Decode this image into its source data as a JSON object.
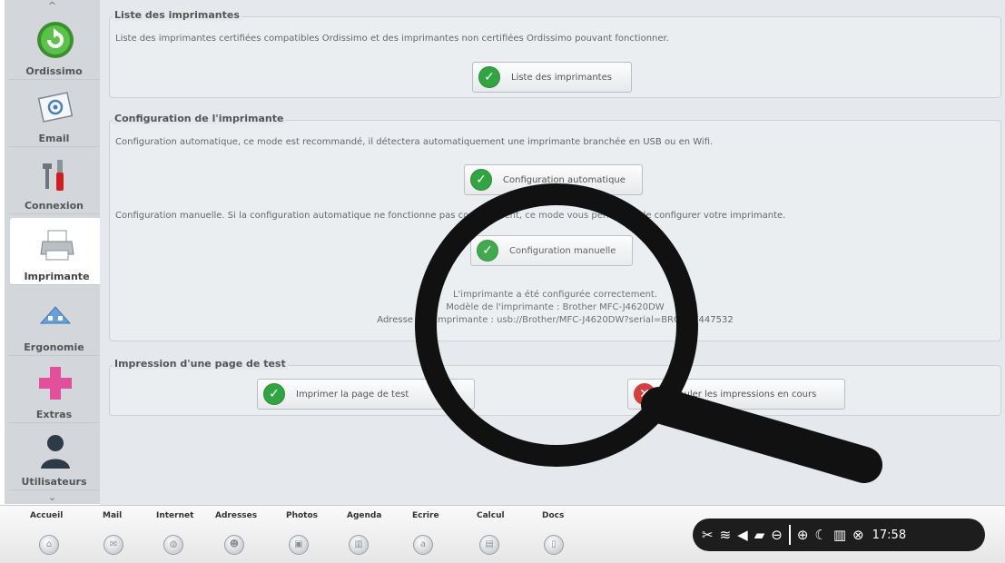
{
  "sidebar": {
    "scroll_up": "^",
    "scroll_down": "⌄",
    "items": [
      {
        "label": "Ordissimo"
      },
      {
        "label": "Email"
      },
      {
        "label": "Connexion"
      },
      {
        "label": "Imprimante"
      },
      {
        "label": "Ergonomie"
      },
      {
        "label": "Extras"
      },
      {
        "label": "Utilisateurs"
      }
    ]
  },
  "printers_list": {
    "title": "Liste des imprimantes",
    "description": "Liste des imprimantes certifiées compatibles Ordissimo et des imprimantes non certifiées Ordissimo pouvant fonctionner.",
    "button": "Liste des imprimantes"
  },
  "config": {
    "title": "Configuration de l'imprimante",
    "auto_text": "Configuration automatique, ce mode est recommandé, il détectera automatiquement une imprimante branchée en USB ou en Wifi.",
    "auto_button": "Configuration automatique",
    "manual_text": "Configuration manuelle. Si la configuration automatique ne fonctionne pas correctement, ce mode vous permettra de configurer votre imprimante.",
    "manual_button": "Configuration manuelle",
    "status_1": "L'imprimante a été configurée correctement.",
    "status_2": "Modèle de l'imprimante : Brother MFC-J4620DW",
    "status_3": "Adresse de l'imprimante : usb://Brother/MFC-J4620DW?serial=BROH4F447532"
  },
  "test_page": {
    "title": "Impression d'une page de test",
    "print_button": "Imprimer la page de test",
    "cancel_button": "Annuler les impressions en cours"
  },
  "dock": {
    "items": [
      {
        "label": "Accueil",
        "icon": "home-icon"
      },
      {
        "label": "Mail",
        "icon": "mail-icon"
      },
      {
        "label": "Internet",
        "icon": "globe-icon"
      },
      {
        "label": "Adresses",
        "icon": "contacts-icon"
      },
      {
        "label": "Photos",
        "icon": "photo-icon"
      },
      {
        "label": "Agenda",
        "icon": "calendar-icon"
      },
      {
        "label": "Ecrire",
        "icon": "write-icon"
      },
      {
        "label": "Calcul",
        "icon": "calculator-icon"
      },
      {
        "label": "Docs",
        "icon": "docs-icon"
      }
    ]
  },
  "tray": {
    "clock": "17:58"
  },
  "colors": {
    "sidebar_bg": "#d3d7dc",
    "main_bg": "#e5e8ec",
    "check_green": "#33a442",
    "cancel_red": "#d03131",
    "tray_bg": "#1d1d1d"
  }
}
